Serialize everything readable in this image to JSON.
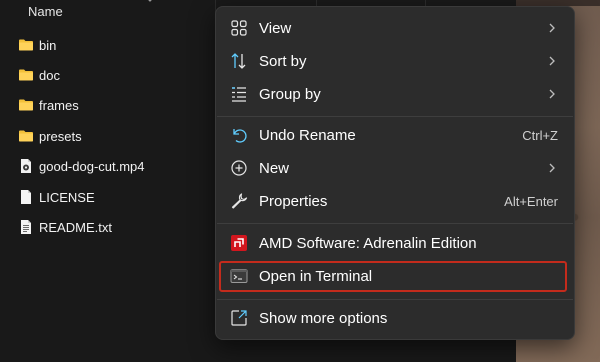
{
  "explorer": {
    "column_name": "Name",
    "files": [
      {
        "name": "bin",
        "icon": "folder-icon"
      },
      {
        "name": "doc",
        "icon": "folder-icon"
      },
      {
        "name": "frames",
        "icon": "folder-icon"
      },
      {
        "name": "presets",
        "icon": "folder-icon"
      },
      {
        "name": "good-dog-cut.mp4",
        "icon": "video-file-icon"
      },
      {
        "name": "LICENSE",
        "icon": "file-icon"
      },
      {
        "name": "README.txt",
        "icon": "text-file-icon"
      }
    ],
    "folder_color": "#f3c13a"
  },
  "context_menu": {
    "items": [
      {
        "label": "View",
        "icon": "grid-icon",
        "submenu": true
      },
      {
        "label": "Sort by",
        "icon": "sort-icon",
        "submenu": true
      },
      {
        "label": "Group by",
        "icon": "list-icon",
        "submenu": true
      },
      {
        "label": "Undo Rename",
        "icon": "undo-icon",
        "shortcut": "Ctrl+Z"
      },
      {
        "label": "New",
        "icon": "plus-circle-icon",
        "submenu": true
      },
      {
        "label": "Properties",
        "icon": "wrench-icon",
        "shortcut": "Alt+Enter"
      },
      {
        "label": "AMD Software: Adrenalin Edition",
        "icon": "amd-logo-icon"
      },
      {
        "label": "Open in Terminal",
        "icon": "terminal-icon",
        "highlighted": true
      },
      {
        "label": "Show more options",
        "icon": "share-icon"
      }
    ],
    "highlight_color": "#c42b1c",
    "accent_color": "#60cdff",
    "amd_color": "#d2161e"
  }
}
